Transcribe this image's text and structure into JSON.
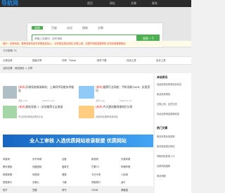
{
  "header": {
    "logo": "导航网",
    "nav": [
      "首页",
      "网址",
      "文章",
      "联系"
    ]
  },
  "search": {
    "tabs": [
      "本地",
      "百度",
      "必应",
      "搜狗",
      "谷歌"
    ],
    "placeholder": "请输入关键词，回车搜索",
    "button": "搜索一下"
  },
  "notice": "提示：优质网站，推荐收录本站可享受免费加入...  请勿提交违法网站  文明上网，请遵守网络道德规范  请勿收录赌博网站",
  "updated": "今天更新 51",
  "categories": [
    "分类目录",
    "搜索引擎",
    "外贸 · Tiktok",
    "软件下载",
    "在线工具",
    "站长工具"
  ],
  "path": "当前位置：网站首页 > 文章",
  "articles": [
    {
      "tag": "[新闻]",
      "title": "闪电导航收录新站：上海同华导航技术服务",
      "desc": "上海同华导航技术服务有限公司成立于..."
    },
    {
      "tag": "[新闻]",
      "title": "网站导航 1 : 好站推荐立足收录",
      "desc": "专业的收录网站导航平台"
    },
    {
      "tag": "[新闻]",
      "title": "推荐行业导航：手机导航2026，实用资讯",
      "desc": "2026年11月推荐收录网站一手机导航"
    },
    {
      "tag": "[新闻]",
      "title": "今天建站数网络知识分享",
      "desc": "优质网站推荐收录网站"
    }
  ],
  "meta": [
    "浏览 (12)",
    "2026-11-12",
    "浏览 (12)",
    "2026-11-12"
  ],
  "banner": "全人工审核  入选优质网站收录联盟  优质网站",
  "links": [
    [
      "淘宝网",
      "京东商城",
      "百度",
      "新浪网",
      "天猫商城"
    ],
    [
      "腾讯视频",
      "优酷视频",
      "爱奇艺",
      "芒果TV",
      "哔哩哔哩"
    ],
    [
      "网易新闻",
      "凤凰网",
      "搜狐",
      "今日头条",
      "人民网"
    ],
    [
      "携程旅行",
      "去哪儿",
      "飞猪",
      "同程旅行",
      "途牛"
    ],
    [
      "知乎",
      "豆瓣",
      "简书",
      "CSDN",
      "博客园"
    ]
  ],
  "sidebar": {
    "h1": "本站资讯",
    "items1": [
      "欢迎收录优质网站到本站",
      "新站收录规则",
      "文明上网，友好交流",
      "本站优质网站推荐收录"
    ],
    "h2": "热门文章",
    "items2": [
      "网站收录标准说明",
      "如何免费提交网站",
      "导航网站收录入口",
      "优质网站推荐",
      "网站地图"
    ]
  }
}
